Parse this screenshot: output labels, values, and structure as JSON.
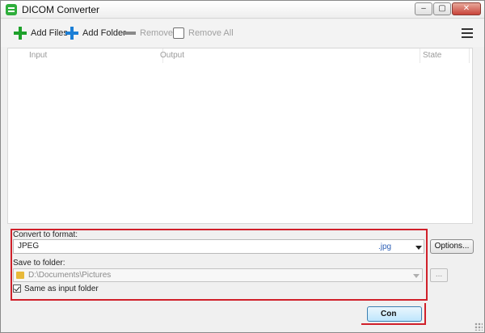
{
  "window": {
    "title": "DICOM Converter",
    "controls": {
      "minimize": "–",
      "maximize": "▢",
      "close": "✕"
    }
  },
  "toolbar": {
    "add_files": "Add Files",
    "add_folder": "Add Folder",
    "remove": "Remove",
    "remove_all": "Remove All",
    "menu_icon": "hamburger-menu-icon"
  },
  "list": {
    "columns": [
      "Input",
      "Output",
      "State"
    ]
  },
  "convert": {
    "label": "Convert to format:",
    "format": "JPEG",
    "extension": ".jpg",
    "options_button": "Options..."
  },
  "save": {
    "label": "Save to folder:",
    "path": "D:\\Documents\\Pictures",
    "browse_button": "...",
    "same_as_input_label": "Same as input folder",
    "same_as_input_checked": true
  },
  "actions": {
    "convert_button": "Con"
  },
  "colors": {
    "highlight_border": "#d0202a",
    "add_files_icon": "#1ea12b",
    "add_folder_icon": "#1c7fd6",
    "extension_text": "#2d5fb6"
  }
}
